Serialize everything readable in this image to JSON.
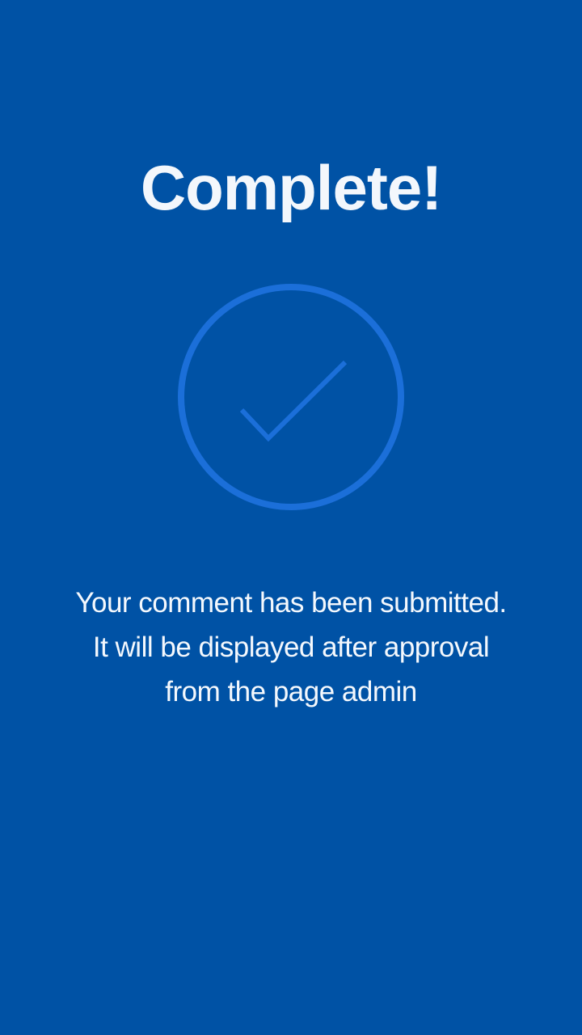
{
  "screen": {
    "title": "Complete!",
    "icon": "checkmark-circle-icon",
    "message_lines": [
      "Your comment has been submitted.",
      "It will be displayed after approval",
      "from the page admin"
    ]
  },
  "colors": {
    "background": "#0052a5",
    "icon_stroke": "#1b6fd9",
    "text": "#f4f8fd"
  }
}
